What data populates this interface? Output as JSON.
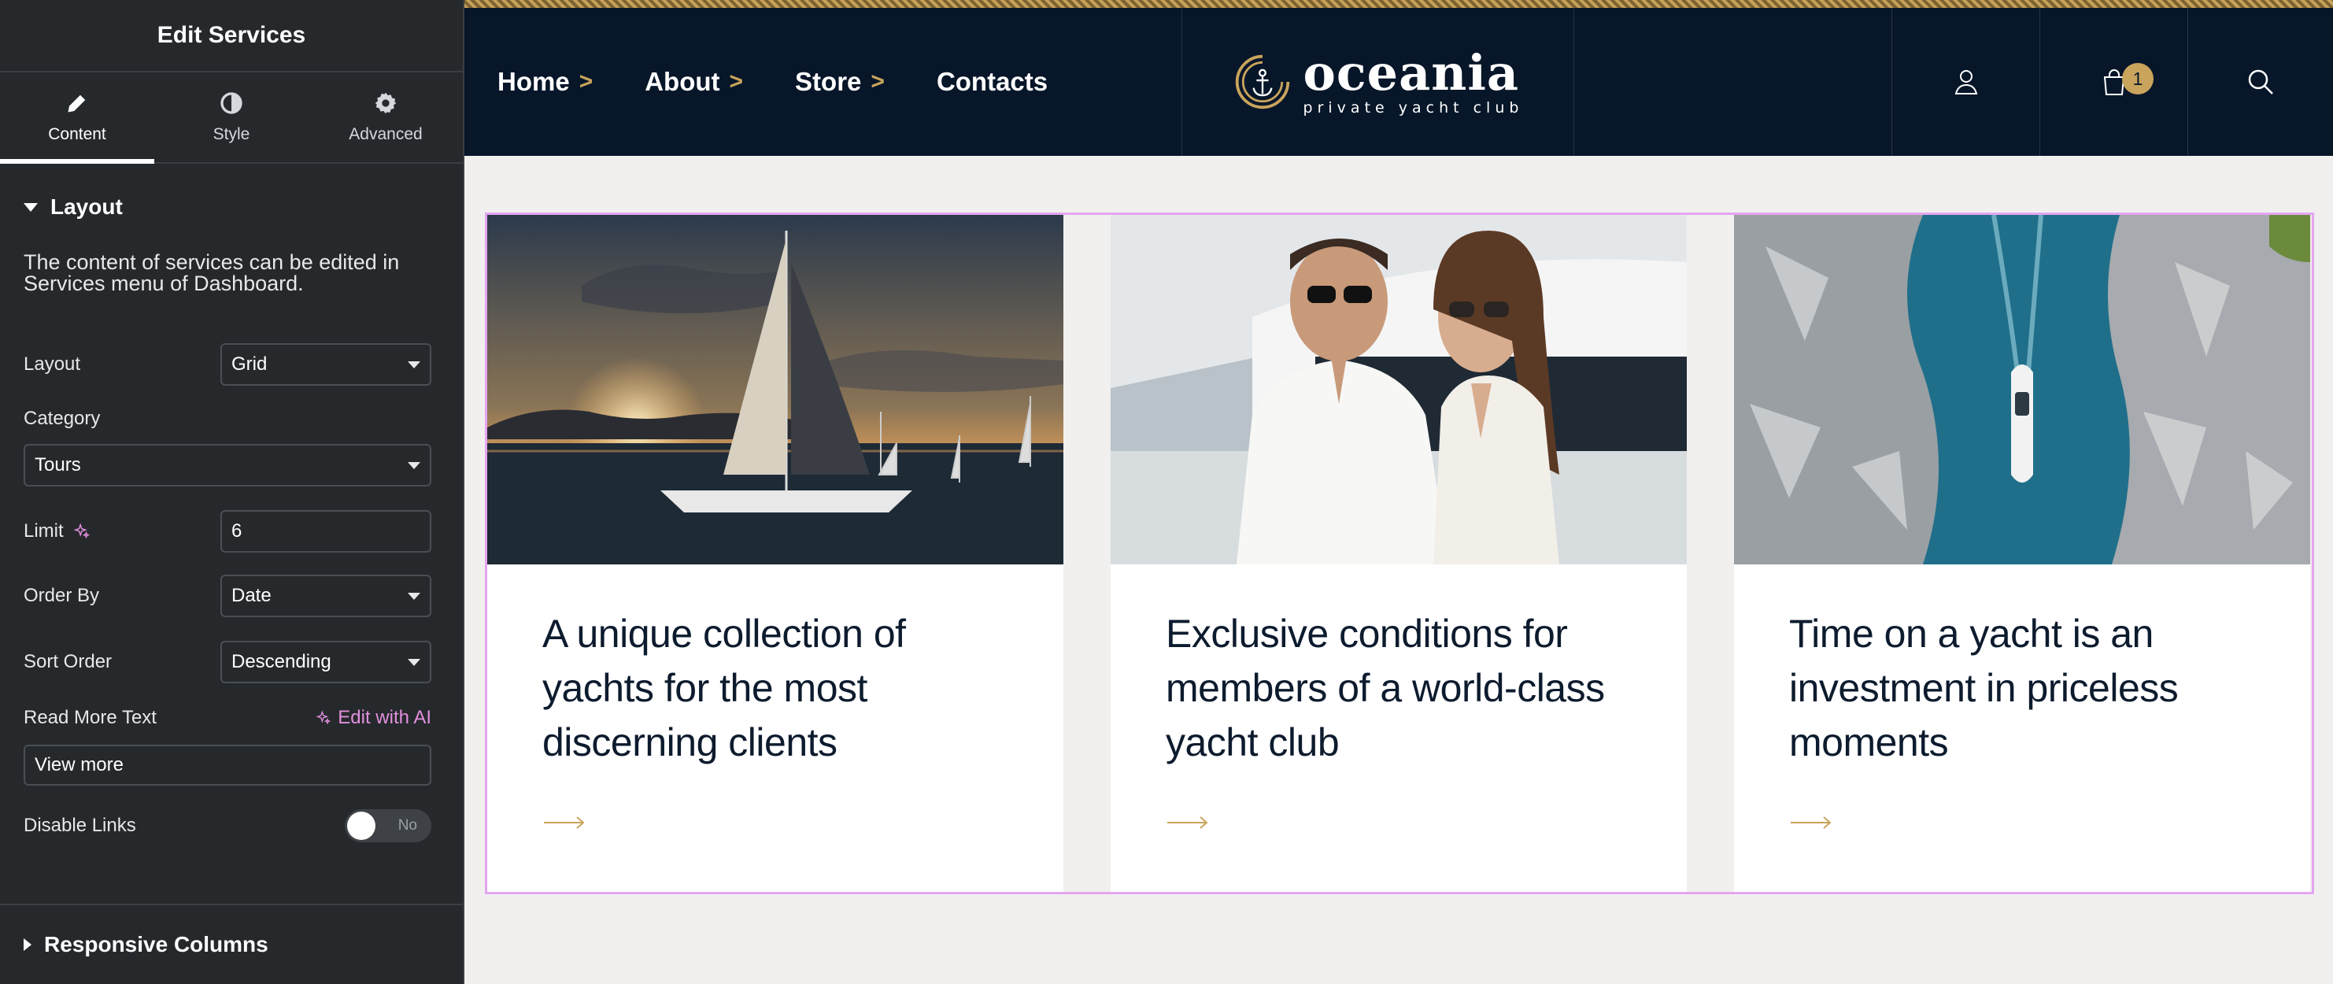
{
  "panel": {
    "title": "Edit Services",
    "tabs": [
      {
        "label": "Content",
        "icon": "pencil-icon"
      },
      {
        "label": "Style",
        "icon": "half-circle-icon"
      },
      {
        "label": "Advanced",
        "icon": "gear-icon"
      }
    ],
    "layout_section": "Layout",
    "note": "The content of services can be edited in Services menu of Dashboard.",
    "fields": {
      "layout": {
        "label": "Layout",
        "value": "Grid"
      },
      "category": {
        "label": "Category",
        "value": "Tours"
      },
      "limit": {
        "label": "Limit",
        "value": "6"
      },
      "order_by": {
        "label": "Order By",
        "value": "Date"
      },
      "sort_order": {
        "label": "Sort Order",
        "value": "Descending"
      },
      "read_more": {
        "label": "Read More Text",
        "value": "View more",
        "ai_label": "Edit with AI"
      },
      "disable_links": {
        "label": "Disable Links",
        "value": "No"
      }
    },
    "responsive_section": "Responsive Columns",
    "accent_color": "#e28fdd"
  },
  "site": {
    "nav": [
      {
        "label": "Home",
        "chevron": ">"
      },
      {
        "label": "About",
        "chevron": ">"
      },
      {
        "label": "Store",
        "chevron": ">"
      },
      {
        "label": "Contacts",
        "chevron": ""
      }
    ],
    "logo": {
      "name": "oceania",
      "tagline": "private yacht club"
    },
    "cart_count": "1",
    "icons": [
      "user-icon",
      "cart-icon",
      "search-icon"
    ],
    "cards": [
      {
        "title": "A unique collection of yachts for the most discerning clients",
        "image": "sailboat-sunset-photo"
      },
      {
        "title": "Exclusive conditions for members of a world-class yacht club",
        "image": "couple-on-yacht-photo"
      },
      {
        "title": "Time on a yacht is an investment in priceless moments",
        "image": "yacht-aerial-photo"
      }
    ],
    "colors": {
      "navy": "#071629",
      "gold": "#c9a45c",
      "background": "#f1f0ee",
      "selection": "#e5a5f2"
    }
  }
}
